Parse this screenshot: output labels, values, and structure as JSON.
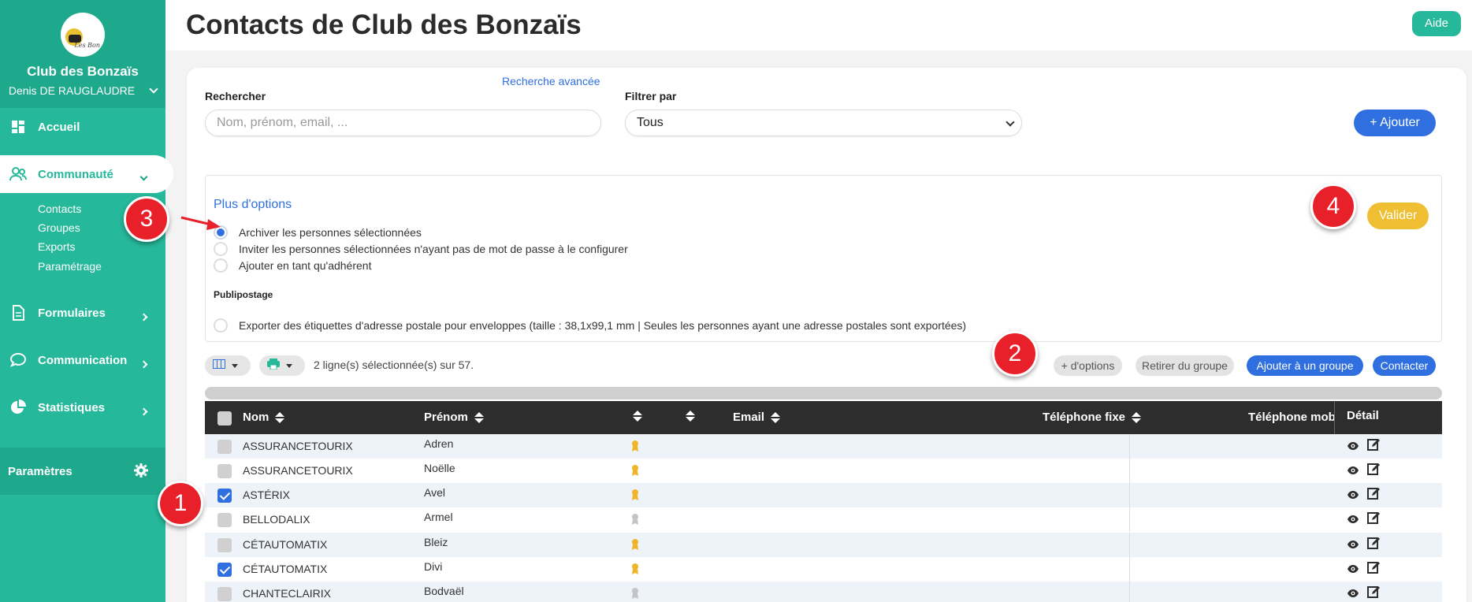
{
  "sidebar": {
    "club_name": "Club des Bonzaïs",
    "user_name": "Denis DE RAUGLAUDRE",
    "logo_text": "Les Bon",
    "items": [
      {
        "label": "Accueil",
        "icon": "dashboard-icon"
      },
      {
        "label": "Communauté",
        "icon": "users-icon"
      },
      {
        "label": "Formulaires",
        "icon": "document-icon"
      },
      {
        "label": "Communication",
        "icon": "chat-icon"
      },
      {
        "label": "Statistiques",
        "icon": "pie-chart-icon"
      }
    ],
    "sub_items": [
      "Contacts",
      "Groupes",
      "Exports",
      "Paramétrage"
    ],
    "params_label": "Paramètres"
  },
  "header": {
    "title": "Contacts de Club des Bonzaïs",
    "help_label": "Aide"
  },
  "filters": {
    "search_label": "Rechercher",
    "search_placeholder": "Nom, prénom, email, ...",
    "advanced_link": "Recherche avancée",
    "filter_label": "Filtrer par",
    "filter_value": "Tous",
    "add_label": "+ Ajouter"
  },
  "options": {
    "title": "Plus d'options",
    "radios": [
      "Archiver les personnes sélectionnées",
      "Inviter les personnes sélectionnées n'ayant pas de mot de passe à le configurer",
      "Ajouter en tant qu'adhérent"
    ],
    "publipostage_label": "Publipostage",
    "publipostage_radio": "Exporter des étiquettes d'adresse postale pour enveloppes (taille : 38,1x99,1 mm | Seules les personnes ayant une adresse postales sont exportées)",
    "validate_label": "Valider"
  },
  "toolbar": {
    "selection_text": "2 ligne(s) sélectionnée(s) sur 57.",
    "more_options": "+ d'options",
    "remove_group": "Retirer du groupe",
    "add_group": "Ajouter à un groupe",
    "contact": "Contacter"
  },
  "table": {
    "headers": {
      "nom": "Nom",
      "prenom": "Prénom",
      "email": "Email",
      "tel_fixe": "Téléphone fixe",
      "tel_mobile": "Téléphone mobile",
      "detail": "Détail"
    },
    "rows": [
      {
        "nom": "ASSURANCETOURIX",
        "prenom": "Adren",
        "checked": false,
        "badge": "gold"
      },
      {
        "nom": "ASSURANCETOURIX",
        "prenom": "Noëlle",
        "checked": false,
        "badge": "gold"
      },
      {
        "nom": "ASTÉRIX",
        "prenom": "Avel",
        "checked": true,
        "badge": "gold"
      },
      {
        "nom": "BELLODALIX",
        "prenom": "Armel",
        "checked": false,
        "badge": "grey"
      },
      {
        "nom": "CÉTAUTOMATIX",
        "prenom": "Bleiz",
        "checked": false,
        "badge": "gold"
      },
      {
        "nom": "CÉTAUTOMATIX",
        "prenom": "Divi",
        "checked": true,
        "badge": "gold"
      },
      {
        "nom": "CHANTECLAIRIX",
        "prenom": "Bodvaël",
        "checked": false,
        "badge": "grey"
      }
    ]
  },
  "steps": [
    "1",
    "2",
    "3",
    "4"
  ],
  "colors": {
    "brand": "#26b89a",
    "accent_blue": "#2f6fdf",
    "validate": "#f0be32",
    "step_marker": "#e8202a"
  }
}
